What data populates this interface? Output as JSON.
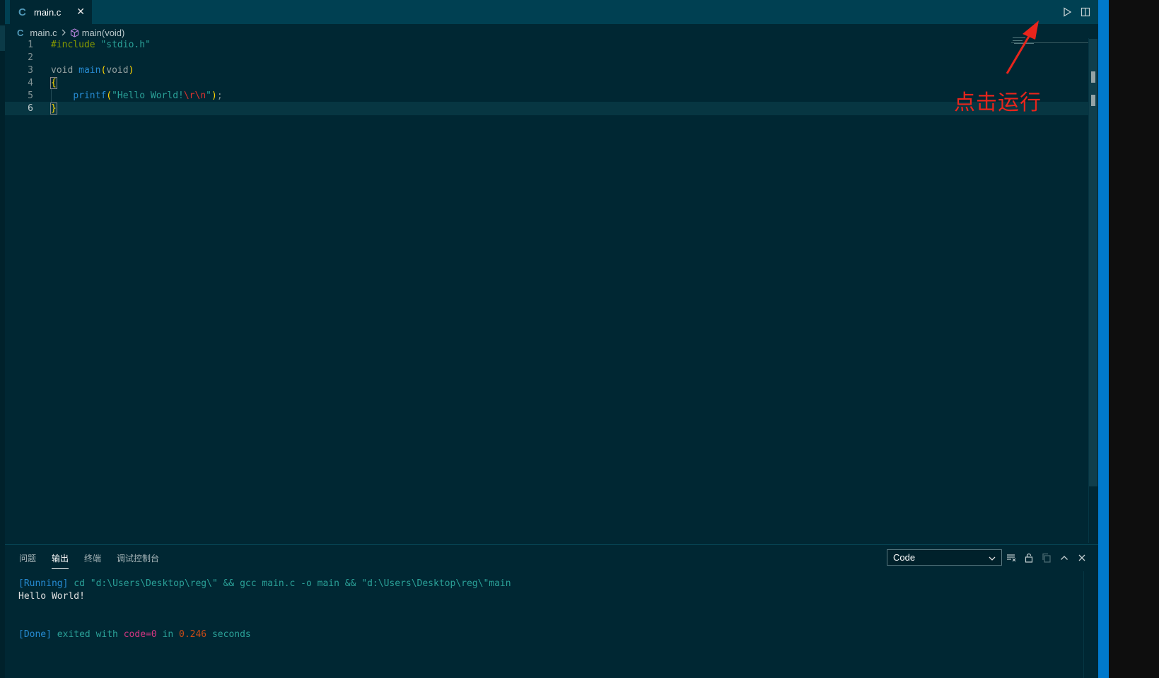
{
  "tab": {
    "icon": "C",
    "label": "main.c",
    "close": "✕"
  },
  "breadcrumb": {
    "file": "main.c",
    "symbol": "main(void)"
  },
  "code": {
    "lines": [
      "1",
      "2",
      "3",
      "4",
      "5",
      "6"
    ],
    "l1_pre": "#include",
    "l1_str": "\"stdio.h\"",
    "l3_kw": "void",
    "l3_fn": "main",
    "l3_open": "(",
    "l3_kw2": "void",
    "l3_close": ")",
    "l4_brace": "{",
    "l5_fn": "printf",
    "l5_open": "(",
    "l5_str": "\"Hello World!",
    "l5_esc": "\\r\\n",
    "l5_str_end": "\"",
    "l5_close": ")",
    "l5_semi": ";",
    "l6_brace": "}"
  },
  "annotation": {
    "text": "点击运行",
    "color": "#e8251c"
  },
  "panel": {
    "tabs": [
      "问题",
      "输出",
      "终端",
      "调试控制台"
    ],
    "active_tab": "输出",
    "select_value": "Code"
  },
  "output": {
    "running_tag": "[Running]",
    "running_cmd": " cd \"d:\\Users\\Desktop\\reg\\\" && gcc main.c -o main && \"d:\\Users\\Desktop\\reg\\\"main",
    "hello": "Hello World!",
    "done_tag": "[Done]",
    "done_exited": " exited with ",
    "done_code": "code=0",
    "done_in": " in ",
    "done_time": "0.246",
    "done_seconds": " seconds"
  },
  "colors": {
    "background": "#002733",
    "tabbar": "#004052",
    "accent": "#0079cc"
  },
  "icons": [
    "c-file-icon",
    "close-icon",
    "run-icon",
    "split-editor-icon",
    "more-actions-icon",
    "chevron-right-icon",
    "cube-icon",
    "clear-output-icon",
    "lock-icon",
    "copy-icon",
    "chevron-up-icon",
    "close-panel-icon"
  ]
}
